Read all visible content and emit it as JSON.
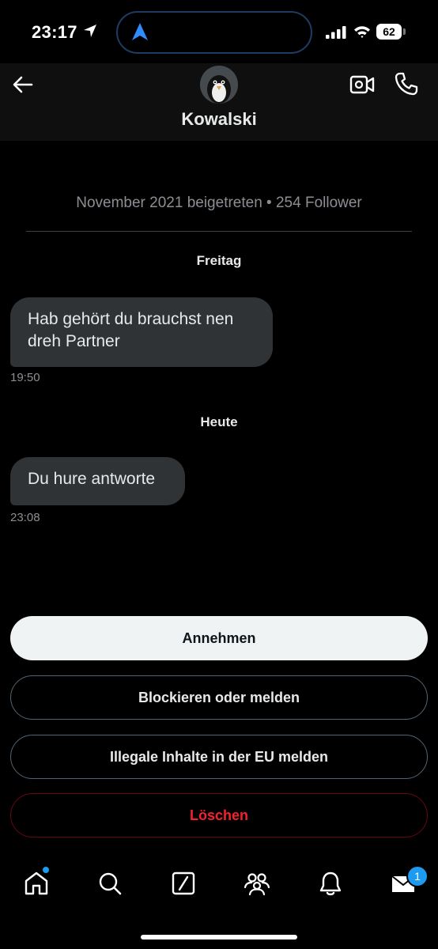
{
  "status_bar": {
    "time": "23:17",
    "battery": "62"
  },
  "header": {
    "contact_name": "Kowalski"
  },
  "conversation": {
    "joined_info": "November 2021 beigetreten • 254 Follower",
    "groups": [
      {
        "day": "Freitag",
        "message_lines": [
          "Hab gehört du brauchst nen",
          "dreh Partner"
        ],
        "time": "19:50"
      },
      {
        "day": "Heute",
        "message_lines": [
          "Du hure antworte"
        ],
        "time": "23:08"
      }
    ]
  },
  "actions": {
    "accept": "Annehmen",
    "block_report": "Blockieren oder melden",
    "report_eu": "Illegale Inhalte in der EU melden",
    "delete": "Löschen"
  },
  "tab_bar": {
    "items": [
      "home-icon",
      "search-icon",
      "grok-icon",
      "communities-icon",
      "notifications-icon",
      "messages-icon"
    ],
    "messages_badge": "1"
  },
  "colors": {
    "accent": "#1d9bf0",
    "danger": "#f4212e",
    "bubble": "#2f3336"
  }
}
